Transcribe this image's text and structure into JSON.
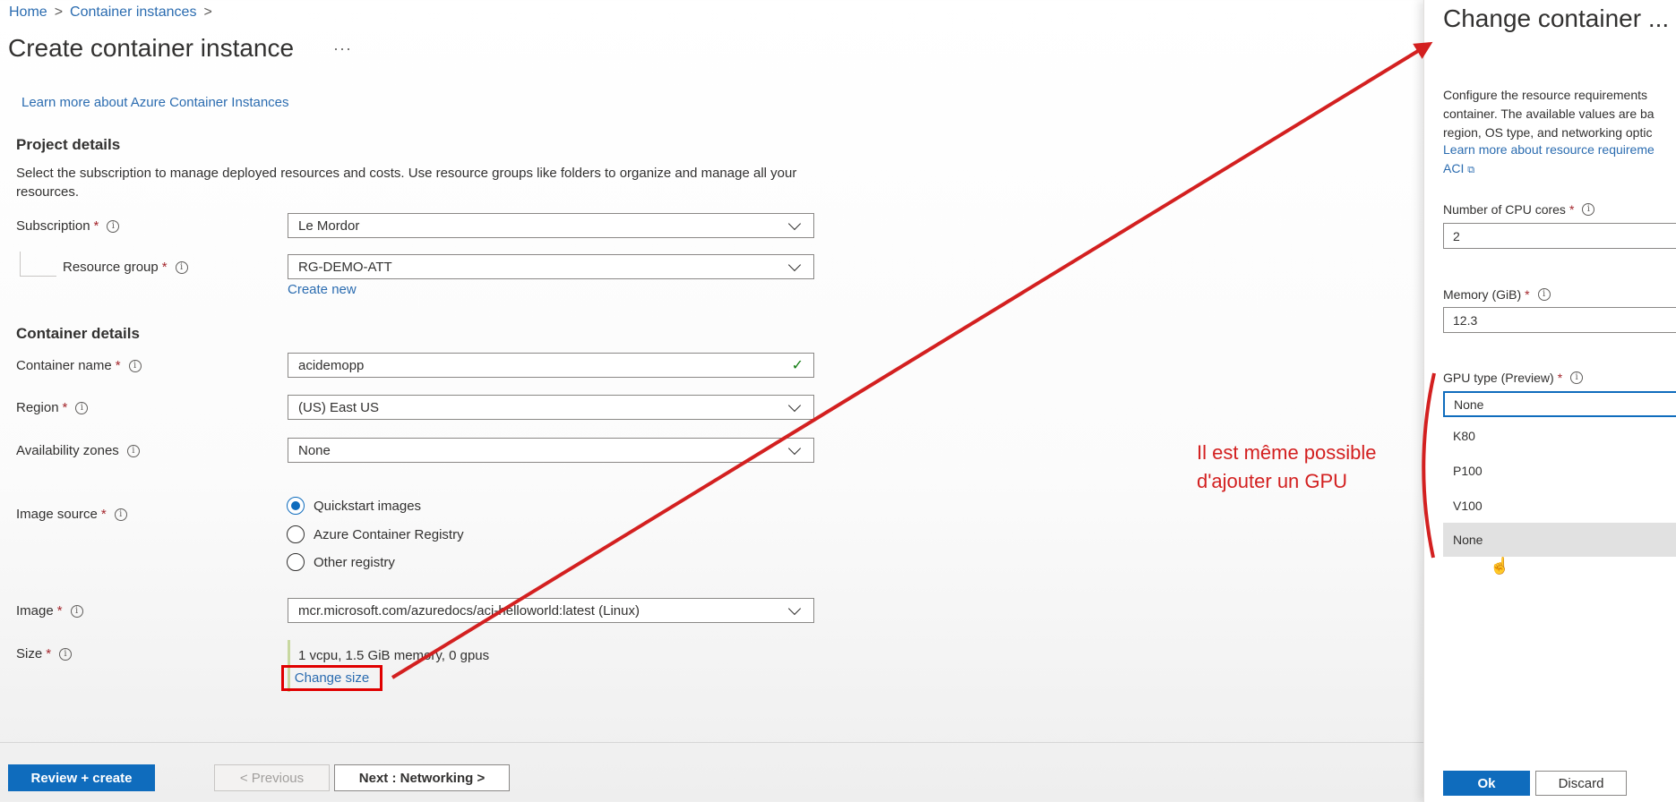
{
  "breadcrumb": {
    "home": "Home",
    "parent": "Container instances",
    "sep": ">"
  },
  "page_title": "Create container instance",
  "more_label": "···",
  "learn_more": "Learn more about Azure Container Instances",
  "project": {
    "heading": "Project details",
    "description": "Select the subscription to manage deployed resources and costs. Use resource groups like folders to organize and manage all your resources.",
    "subscription_label": "Subscription",
    "subscription_value": "Le Mordor",
    "resource_group_label": "Resource group",
    "resource_group_value": "RG-DEMO-ATT",
    "create_new": "Create new"
  },
  "container": {
    "heading": "Container details",
    "name_label": "Container name",
    "name_value": "acidemopp",
    "region_label": "Region",
    "region_value": "(US) East US",
    "zones_label": "Availability zones",
    "zones_value": "None",
    "image_source_label": "Image source",
    "image_source_options": [
      "Quickstart images",
      "Azure Container Registry",
      "Other registry"
    ],
    "image_label": "Image",
    "image_value": "mcr.microsoft.com/azuredocs/aci-helloworld:latest (Linux)",
    "size_label": "Size",
    "size_value": "1 vcpu, 1.5 GiB memory, 0 gpus",
    "change_size": "Change size"
  },
  "footer": {
    "review_create": "Review + create",
    "previous": "< Previous",
    "next": "Next : Networking >"
  },
  "panel": {
    "title": "Change container ...",
    "description": "Configure the resource requirements\ncontainer. The available values are ba\nregion, OS type, and networking optic",
    "learn_more": "Learn more about resource requireme",
    "learn_more_2": "ACI",
    "cpu_label": "Number of CPU cores",
    "cpu_value": "2",
    "memory_label": "Memory (GiB)",
    "memory_value": "12.3",
    "gpu_label": "GPU type (Preview)",
    "gpu_value": "None",
    "gpu_options": [
      "K80",
      "P100",
      "V100",
      "None"
    ],
    "ok": "Ok",
    "discard": "Discard"
  },
  "annotation": "Il est même possible\nd'ajouter un GPU",
  "colors": {
    "accent": "#0f6cbd",
    "link": "#2b6cb0",
    "annotation": "#d32020",
    "required": "#a4262c"
  }
}
